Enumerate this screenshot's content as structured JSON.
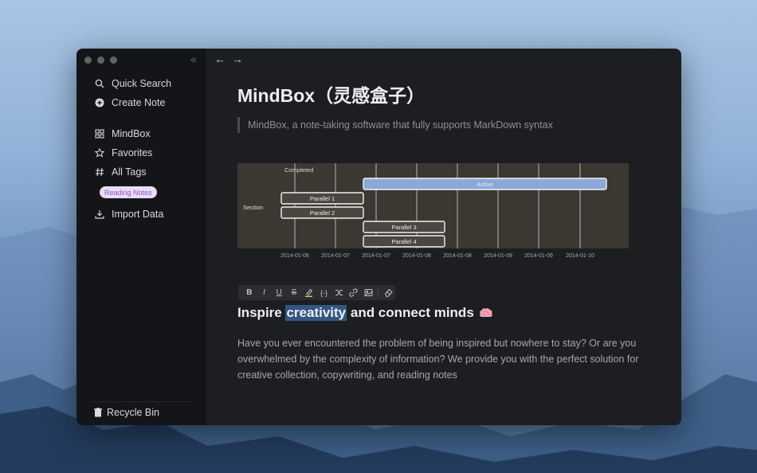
{
  "sidebar": {
    "quick_search": "Quick Search",
    "create_note": "Create Note",
    "items": [
      {
        "label": "MindBox"
      },
      {
        "label": "Favorites"
      },
      {
        "label": "All Tags"
      }
    ],
    "tag": "Reading Notes",
    "import_data": "Import Data",
    "recycle_bin": "Recycle Bin"
  },
  "doc": {
    "title": "MindBox（灵感盒子）",
    "quote": "MindBox, a note-taking software that fully supports MarkDown syntax",
    "heading_before": "Inspire ",
    "heading_highlight": "creativity",
    "heading_after": " and connect minds",
    "paragraph": "Have you ever encountered the problem of being inspired but nowhere to stay? Or are you overwhelmed by the complexity of information? We provide you with the perfect solution for creative collection, copywriting, and reading notes"
  },
  "toolbar": {
    "buttons": [
      "B",
      "I",
      "U",
      "S",
      "highlighter",
      "{-}",
      "link",
      "image",
      "eraser"
    ]
  },
  "gantt": {
    "section": "Section",
    "completed_label": "Completed",
    "tasks": [
      {
        "name": "Active",
        "start": "2014-01-07",
        "end": "2014-01-10"
      },
      {
        "name": "Parallel 1",
        "start": "2014-01-06",
        "end": "2014-01-07"
      },
      {
        "name": "Parallel 2",
        "start": "2014-01-06",
        "end": "2014-01-07"
      },
      {
        "name": "Parallel 3",
        "start": "2014-01-07",
        "end": "2014-01-08"
      },
      {
        "name": "Parallel 4",
        "start": "2014-01-07",
        "end": "2014-01-08"
      }
    ],
    "ticks": [
      "2014-01-06",
      "2014-01-07",
      "2014-01-07",
      "2014-01-08",
      "2014-01-08",
      "2014-01-09",
      "2014-01-09",
      "2014-01-10"
    ]
  },
  "colors": {
    "active_bar": "#8aa9d9",
    "task_bar": "#4a4640",
    "gantt_bg": "#3b3832",
    "tag_bg": "#eadcf6",
    "tag_text": "#8c58c2",
    "highlight": "#34557e"
  }
}
